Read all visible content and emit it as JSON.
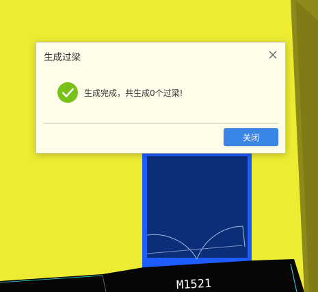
{
  "dialog": {
    "title": "生成过梁",
    "message": "生成完成，共生成0个过梁!",
    "close_button": "关闭",
    "icons": {
      "close": "close-icon",
      "status": "success-check-icon"
    }
  },
  "drawing": {
    "door_tag": "M1521"
  },
  "colors": {
    "background": "#ecec32",
    "door_fill": "#0b2e79",
    "door_outline": "#1e5cff",
    "accent": "#3a86e6",
    "success": "#79c018"
  }
}
